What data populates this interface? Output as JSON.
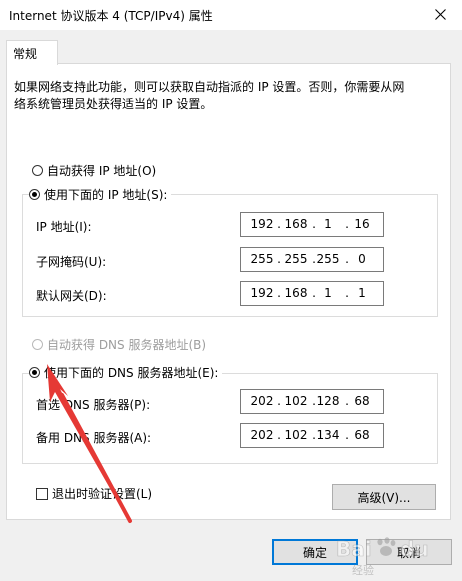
{
  "window": {
    "title": "Internet 协议版本 4 (TCP/IPv4) 属性",
    "close_icon": "close-icon"
  },
  "tabs": [
    {
      "label": "常规",
      "selected": true
    }
  ],
  "description": {
    "line1": "如果网络支持此功能，则可以获取自动指派的 IP 设置。否则，你需要从网",
    "line2": "络系统管理员处获得适当的 IP 设置。"
  },
  "ip_mode": {
    "auto_label": "自动获得 IP 地址(O)",
    "manual_label": "使用下面的 IP 地址(S):",
    "selected": "manual"
  },
  "ip_fields": [
    {
      "label": "IP 地址(I):",
      "octets": [
        "192",
        "168",
        "1",
        "16"
      ]
    },
    {
      "label": "子网掩码(U):",
      "octets": [
        "255",
        "255",
        "255",
        "0"
      ]
    },
    {
      "label": "默认网关(D):",
      "octets": [
        "192",
        "168",
        "1",
        "1"
      ]
    }
  ],
  "dns_mode": {
    "auto_label": "自动获得 DNS 服务器地址(B)",
    "manual_label": "使用下面的 DNS 服务器地址(E):",
    "selected": "manual",
    "auto_disabled": true
  },
  "dns_fields": [
    {
      "label": "首选 DNS 服务器(P):",
      "octets": [
        "202",
        "102",
        "128",
        "68"
      ]
    },
    {
      "label": "备用 DNS 服务器(A):",
      "octets": [
        "202",
        "102",
        "134",
        "68"
      ]
    }
  ],
  "validate_on_exit": {
    "label": "退出时验证设置(L)",
    "checked": false
  },
  "buttons": {
    "advanced": "高级(V)...",
    "ok": "确定",
    "cancel": "取消"
  },
  "watermark": {
    "brand": "Bai",
    "brand2": "du",
    "sub": "经验"
  },
  "colors": {
    "accent": "#0078d7",
    "arrow": "#e53935"
  }
}
